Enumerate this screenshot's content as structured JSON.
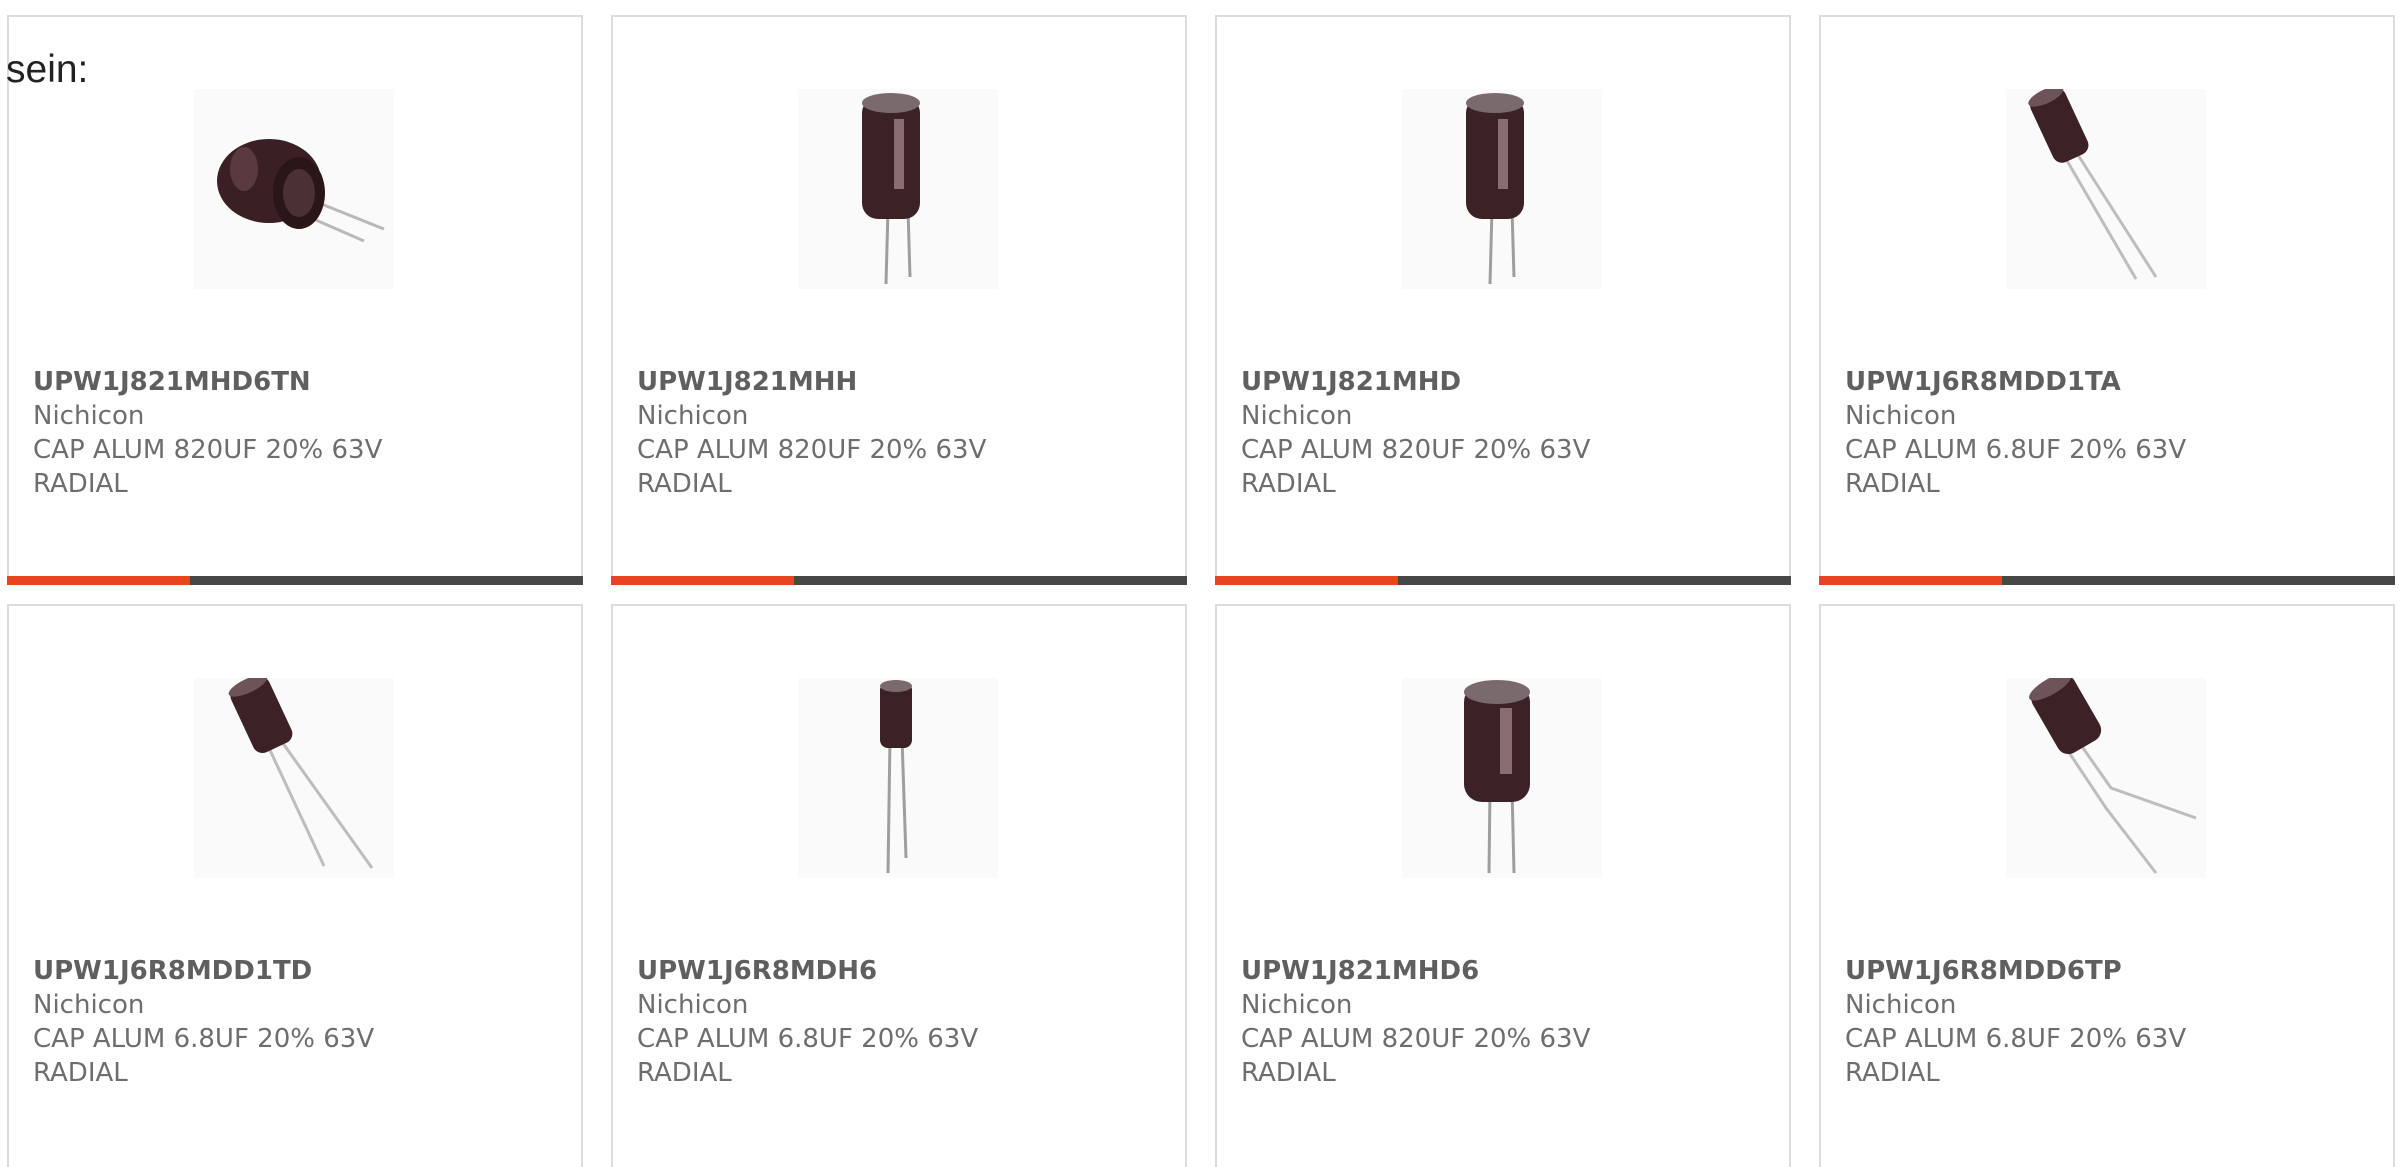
{
  "intro": {
    "text": "sein:"
  },
  "colors": {
    "accent": "#e8441f",
    "bar": "#474747",
    "text": "#6e6e6e",
    "border": "#dcdcdc"
  },
  "products": [
    {
      "part": "UPW1J821MHD6TN",
      "maker": "Nichicon",
      "desc1": "CAP ALUM 820UF 20% 63V",
      "desc2": "RADIAL",
      "image": "capacitor-tilted-image"
    },
    {
      "part": "UPW1J821MHH",
      "maker": "Nichicon",
      "desc1": "CAP ALUM 820UF 20% 63V",
      "desc2": "RADIAL",
      "image": "capacitor-upright-image"
    },
    {
      "part": "UPW1J821MHD",
      "maker": "Nichicon",
      "desc1": "CAP ALUM 820UF 20% 63V",
      "desc2": "RADIAL",
      "image": "capacitor-upright-image"
    },
    {
      "part": "UPW1J6R8MDD1TA",
      "maker": "Nichicon",
      "desc1": "CAP ALUM 6.8UF 20% 63V",
      "desc2": "RADIAL",
      "image": "capacitor-small-angled-image"
    },
    {
      "part": "UPW1J6R8MDD1TD",
      "maker": "Nichicon",
      "desc1": "CAP ALUM 6.8UF 20% 63V",
      "desc2": "RADIAL",
      "image": "capacitor-small-angled-image"
    },
    {
      "part": "UPW1J6R8MDH6",
      "maker": "Nichicon",
      "desc1": "CAP ALUM 6.8UF 20% 63V",
      "desc2": "RADIAL",
      "image": "capacitor-small-upright-image"
    },
    {
      "part": "UPW1J821MHD6",
      "maker": "Nichicon",
      "desc1": "CAP ALUM 820UF 20% 63V",
      "desc2": "RADIAL",
      "image": "capacitor-upright-image"
    },
    {
      "part": "UPW1J6R8MDD6TP",
      "maker": "Nichicon",
      "desc1": "CAP ALUM 6.8UF 20% 63V",
      "desc2": "RADIAL",
      "image": "capacitor-bent-leads-image"
    }
  ]
}
